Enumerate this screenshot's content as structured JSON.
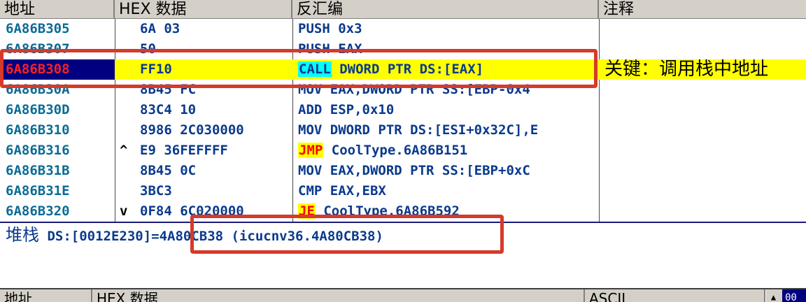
{
  "columns": {
    "address": "地址",
    "hex": "HEX 数据",
    "disasm": "反汇编",
    "comment": "注释"
  },
  "rows": [
    {
      "addr": "6A86B305",
      "mark": "",
      "hex": "6A 03",
      "op": "PUSH",
      "args": "0x3",
      "comment": ""
    },
    {
      "addr": "6A86B307",
      "mark": "",
      "hex": "50",
      "op": "PUSH",
      "args": "EAX",
      "comment": ""
    },
    {
      "addr": "6A86B308",
      "mark": "",
      "hex": "FF10",
      "op": "CALL",
      "args": "DWORD PTR DS:[EAX]",
      "comment": "关键：调用栈中地址",
      "selected": true
    },
    {
      "addr": "6A86B30A",
      "mark": "",
      "hex": "8B45 FC",
      "op": "MOV",
      "args": "EAX,DWORD PTR SS:[EBP-0x4",
      "comment": ""
    },
    {
      "addr": "6A86B30D",
      "mark": "",
      "hex": "83C4 10",
      "op": "ADD",
      "args": "ESP,0x10",
      "comment": ""
    },
    {
      "addr": "6A86B310",
      "mark": "",
      "hex": "8986 2C030000",
      "op": "MOV",
      "args": "DWORD PTR DS:[ESI+0x32C],E",
      "comment": ""
    },
    {
      "addr": "6A86B316",
      "mark": "^",
      "hex": "E9 36FEFFFF",
      "op": "JMP",
      "args": "CoolType.6A86B151",
      "comment": ""
    },
    {
      "addr": "6A86B31B",
      "mark": "",
      "hex": "8B45 0C",
      "op": "MOV",
      "args": "EAX,DWORD PTR SS:[EBP+0xC",
      "comment": ""
    },
    {
      "addr": "6A86B31E",
      "mark": "",
      "hex": "3BC3",
      "op": "CMP",
      "args": "EAX,EBX",
      "comment": ""
    },
    {
      "addr": "6A86B320",
      "mark": "v",
      "hex": "0F84 6C020000",
      "op": "JE",
      "args": "CoolType.6A86B592",
      "comment": ""
    }
  ],
  "stack": {
    "label": "堆栈",
    "text": "DS:[0012E230]=4A80CB38 (icucnv36.4A80CB38)"
  },
  "dump": {
    "address": "地址",
    "hex": "HEX 数据",
    "ascii": "ASCII",
    "scroll_up_icon": "▲",
    "right_btn": "00"
  },
  "colors": {
    "annotation": "#d63a2a",
    "selection": "#ffff00",
    "selected_addr_bg": "#000080"
  }
}
